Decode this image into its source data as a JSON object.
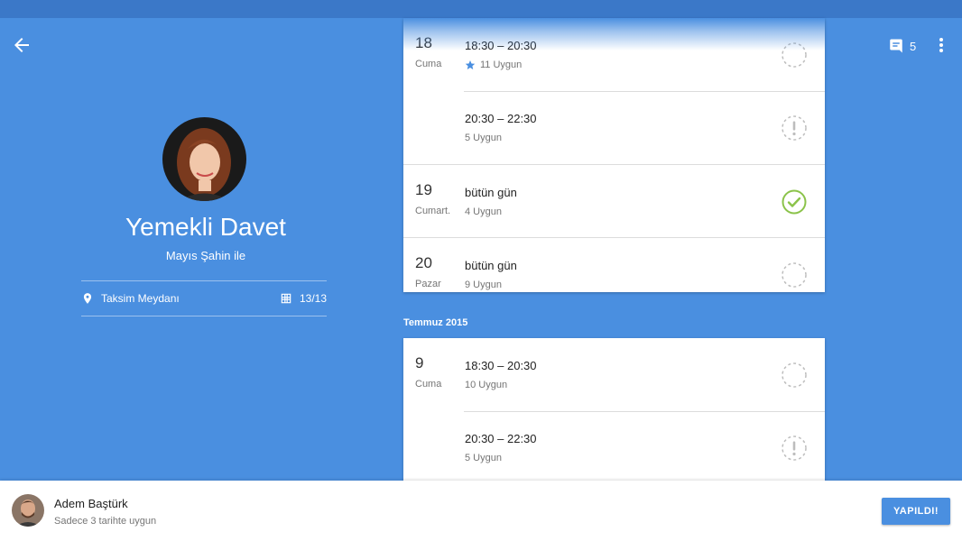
{
  "header": {
    "comments_count": "5"
  },
  "event": {
    "title": "Yemekli Davet",
    "host": "Mayıs Şahin ile",
    "location": "Taksim Meydanı",
    "count": "13/13"
  },
  "months": [
    {
      "name": "",
      "slots": [
        {
          "day": "18",
          "weekday": "Cuma",
          "time": "18:30 – 20:30",
          "available": "11 Uygun",
          "starred": true,
          "status": "empty"
        },
        {
          "day": "",
          "weekday": "",
          "time": "20:30 – 22:30",
          "available": "5 Uygun",
          "starred": false,
          "status": "warning"
        },
        {
          "day": "19",
          "weekday": "Cumart.",
          "time": "bütün gün",
          "available": "4 Uygun",
          "starred": false,
          "status": "selected"
        },
        {
          "day": "20",
          "weekday": "Pazar",
          "time": "bütün gün",
          "available": "9 Uygun",
          "starred": false,
          "status": "empty"
        }
      ]
    },
    {
      "name": "Temmuz 2015",
      "slots": [
        {
          "day": "9",
          "weekday": "Cuma",
          "time": "18:30 – 20:30",
          "available": "10 Uygun",
          "starred": false,
          "status": "empty"
        },
        {
          "day": "",
          "weekday": "",
          "time": "20:30 – 22:30",
          "available": "5  Uygun",
          "starred": false,
          "status": "warning"
        }
      ]
    }
  ],
  "footer": {
    "user_name": "Adem Baştürk",
    "user_note": "Sadece 3 tarihte uygun",
    "done_label": "YAPILDI!"
  },
  "colors": {
    "primary": "#4a8fe0",
    "statusbar": "#3b78c8",
    "selected": "#8bc34a",
    "star": "#4a8fe0"
  }
}
